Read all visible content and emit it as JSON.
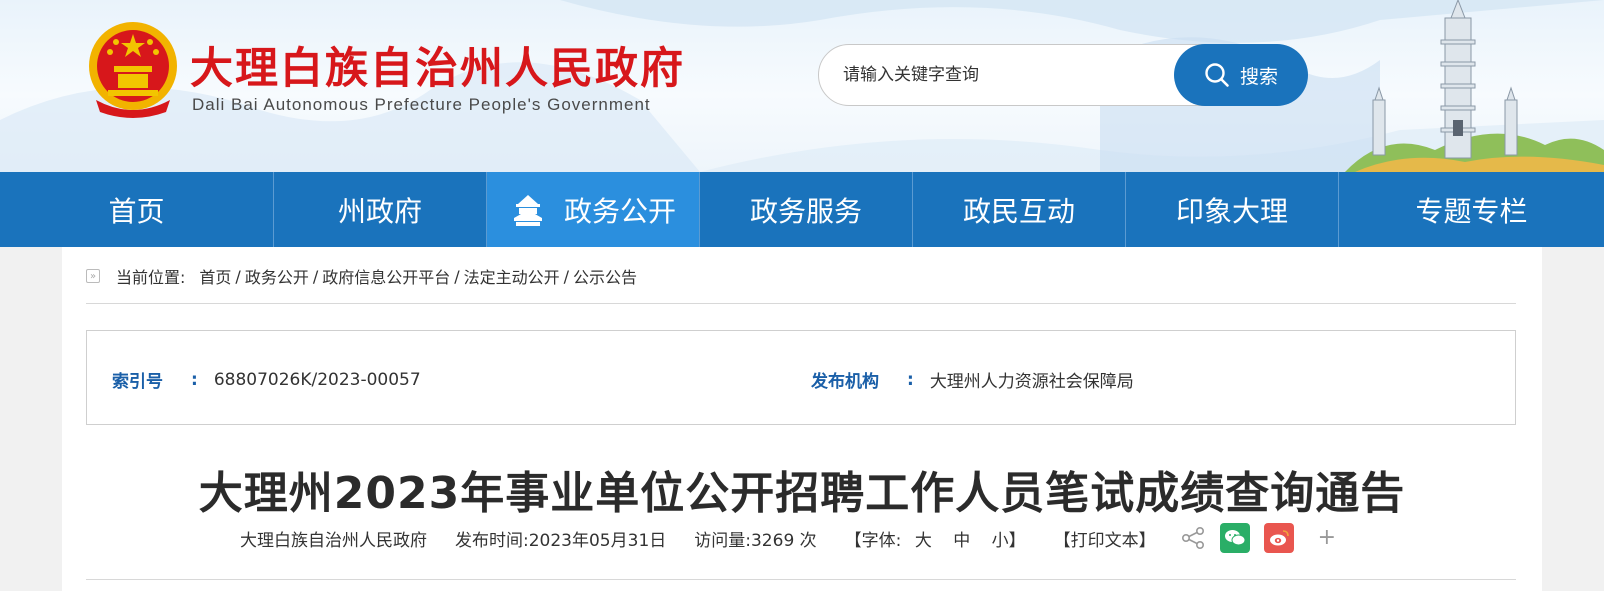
{
  "header": {
    "title_cn": "大理白族自治州人民政府",
    "title_en": "Dali Bai Autonomous Prefecture People's Government",
    "emblem_icon": "national-emblem-icon",
    "search": {
      "placeholder": "请输入关键字查询",
      "button_label": "搜索",
      "icon": "search-icon"
    },
    "accent_color": "#1a73bc",
    "title_color": "#d7171b"
  },
  "nav": {
    "items": [
      {
        "label": "首页"
      },
      {
        "label": "州政府"
      },
      {
        "label": "政务公开",
        "active": true,
        "icon": "temple-icon"
      },
      {
        "label": "政务服务"
      },
      {
        "label": "政民互动"
      },
      {
        "label": "印象大理"
      },
      {
        "label": "专题专栏"
      }
    ]
  },
  "breadcrumb": {
    "prefix": "当前位置:",
    "items": [
      "首页",
      "政务公开",
      "政府信息公开平台",
      "法定主动公开",
      "公示公告"
    ],
    "separator": "/"
  },
  "meta": {
    "index_label": "索引号",
    "index_value": "68807026K/2023-00057",
    "publisher_label": "发布机构",
    "publisher_value": "大理州人力资源社会保障局",
    "colon": ":"
  },
  "article": {
    "title": "大理州2023年事业单位公开招聘工作人员笔试成绩查询通告",
    "source": "大理白族自治州人民政府",
    "publish_time": "发布时间:2023年05月31日",
    "visits": "访问量:3269 次",
    "font_label_open": "【字体:",
    "font_large": "大",
    "font_medium": "中",
    "font_small": "小】",
    "print_label": "【打印文本】",
    "share_icons": [
      "share-icon",
      "wechat-icon",
      "weibo-icon",
      "plus-icon"
    ]
  }
}
